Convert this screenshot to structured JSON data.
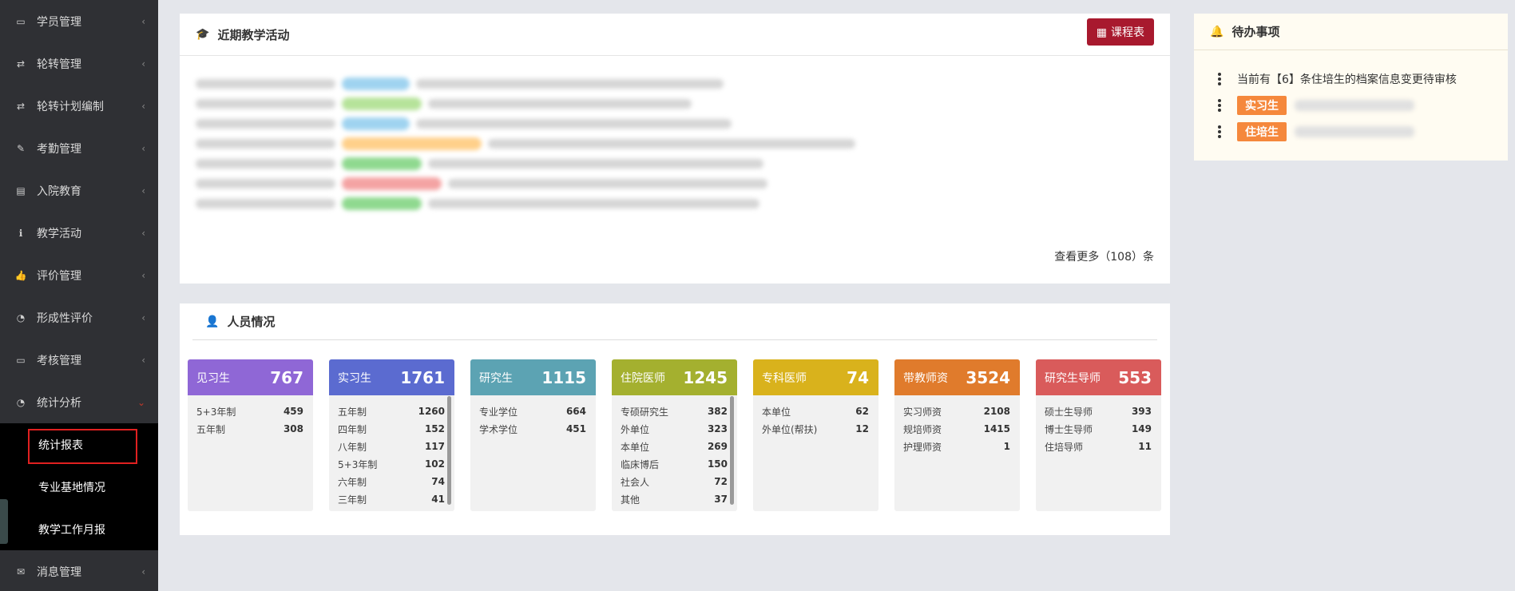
{
  "sidebar": {
    "items": [
      {
        "label": "学员管理",
        "icon": "id-card-icon"
      },
      {
        "label": "轮转管理",
        "icon": "retweet-icon"
      },
      {
        "label": "轮转计划编制",
        "icon": "retweet-icon"
      },
      {
        "label": "考勤管理",
        "icon": "brush-icon"
      },
      {
        "label": "入院教育",
        "icon": "clipboard-icon"
      },
      {
        "label": "教学活动",
        "icon": "stethoscope-icon"
      },
      {
        "label": "评价管理",
        "icon": "thumbs-up-icon"
      },
      {
        "label": "形成性评价",
        "icon": "pie-chart-icon"
      },
      {
        "label": "考核管理",
        "icon": "monitor-icon"
      },
      {
        "label": "统计分析",
        "icon": "pie-chart-icon"
      }
    ],
    "submenu": [
      "统计报表",
      "专业基地情况",
      "教学工作月报"
    ],
    "last_item": {
      "label": "消息管理",
      "icon": "comments-icon"
    },
    "chevron": "‹",
    "chevron_open": "⌄"
  },
  "activity": {
    "title": "近期教学活动",
    "schedule_button": "课程表",
    "more_link": "查看更多（108）条"
  },
  "todo": {
    "title": "待办事项",
    "message": "当前有【6】条住培生的档案信息变更待审核",
    "badge1": "实习生",
    "badge2": "住培生"
  },
  "people": {
    "title": "人员情况",
    "cards": [
      {
        "title": "见习生",
        "total": "767",
        "color": "#8f67d6",
        "rows": [
          [
            "5+3年制",
            "459"
          ],
          [
            "五年制",
            "308"
          ]
        ]
      },
      {
        "title": "实习生",
        "total": "1761",
        "color": "#5b6bd0",
        "rows": [
          [
            "五年制",
            "1260"
          ],
          [
            "四年制",
            "152"
          ],
          [
            "八年制",
            "117"
          ],
          [
            "5+3年制",
            "102"
          ],
          [
            "六年制",
            "74"
          ],
          [
            "三年制",
            "41"
          ],
          [
            "…",
            "…"
          ]
        ]
      },
      {
        "title": "研究生",
        "total": "1115",
        "color": "#5ca3b3",
        "rows": [
          [
            "专业学位",
            "664"
          ],
          [
            "学术学位",
            "451"
          ]
        ]
      },
      {
        "title": "住院医师",
        "total": "1245",
        "color": "#a4b02f",
        "rows": [
          [
            "专硕研究生",
            "382"
          ],
          [
            "外单位",
            "323"
          ],
          [
            "本单位",
            "269"
          ],
          [
            "临床博后",
            "150"
          ],
          [
            "社会人",
            "72"
          ],
          [
            "其他",
            "37"
          ],
          [
            "…",
            "…"
          ]
        ]
      },
      {
        "title": "专科医师",
        "total": "74",
        "color": "#d9b21c",
        "rows": [
          [
            "本单位",
            "62"
          ],
          [
            "外单位(帮扶)",
            "12"
          ]
        ]
      },
      {
        "title": "带教师资",
        "total": "3524",
        "color": "#e07b2c",
        "rows": [
          [
            "实习师资",
            "2108"
          ],
          [
            "规培师资",
            "1415"
          ],
          [
            "护理师资",
            "1"
          ]
        ]
      },
      {
        "title": "研究生导师",
        "total": "553",
        "color": "#d95b5b",
        "rows": [
          [
            "硕士生导师",
            "393"
          ],
          [
            "博士生导师",
            "149"
          ],
          [
            "住培导师",
            "11"
          ]
        ]
      }
    ]
  }
}
